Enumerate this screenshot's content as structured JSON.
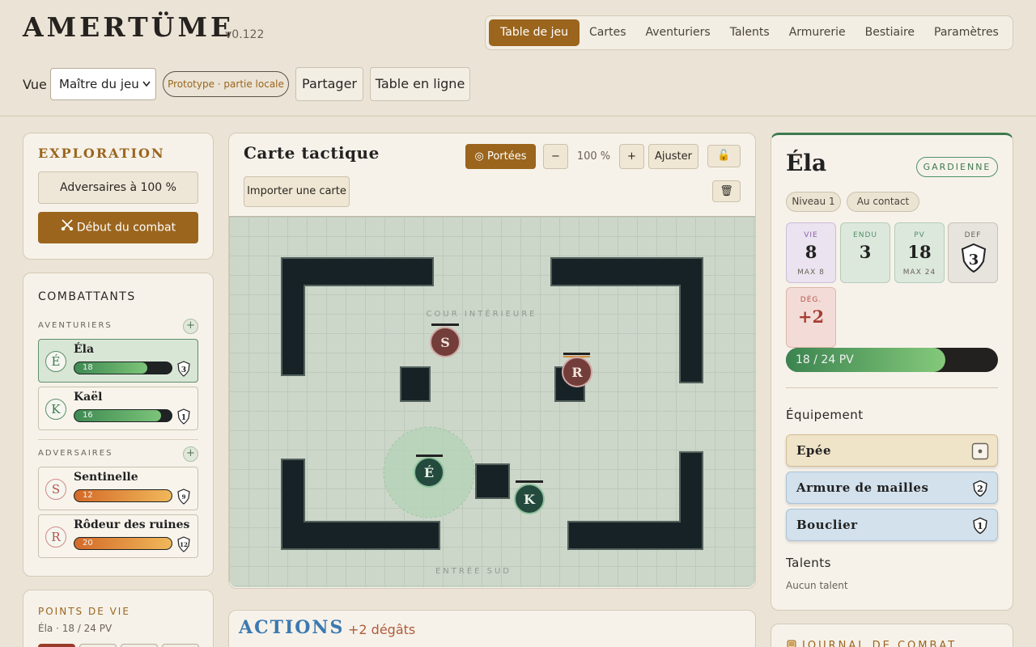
{
  "header": {
    "brand": "AMERTÜME",
    "version": "v0.122",
    "nav": [
      "Table de jeu",
      "Cartes",
      "Aventuriers",
      "Talents",
      "Armurerie",
      "Bestiaire",
      "Paramètres"
    ],
    "view_label": "Vue",
    "view_value": "Maître du jeu",
    "prototype_chip": "Prototype · partie locale",
    "share_button": "Partager",
    "online_button": "Table en ligne"
  },
  "exploration": {
    "title": "EXPLORATION",
    "adversaries_button": "Adversaires à 100 %",
    "start_combat_button": "Début du combat"
  },
  "combatants": {
    "title": "COMBATTANTS",
    "adventurers_label": "AVENTURIERS",
    "adversaries_label": "ADVERSAIRES",
    "adventurers": [
      {
        "initial": "É",
        "name": "Éla",
        "hp": "18",
        "hp_fraction": 0.75,
        "def": "3"
      },
      {
        "initial": "K",
        "name": "Kaël",
        "hp": "16",
        "hp_fraction": 0.89,
        "def": "1"
      }
    ],
    "adversaries": [
      {
        "initial": "S",
        "name": "Sentinelle",
        "hp": "12",
        "hp_fraction": 1.0,
        "def": "9"
      },
      {
        "initial": "R",
        "name": "Rôdeur des ruines",
        "hp": "20",
        "hp_fraction": 1.0,
        "def": "12"
      }
    ]
  },
  "hitpoints": {
    "title": "POINTS DE VIE",
    "subtitle": "Éla · 18 / 24 PV"
  },
  "map": {
    "title": "Carte tactique",
    "ranges_button": "◎ Portées",
    "zoom_out": "−",
    "zoom": "100 %",
    "zoom_in": "+",
    "fit_button": "Ajuster",
    "lock_icon": "🔓",
    "import_button": "Importer une carte",
    "trash_icon": "🗑",
    "label_courtyard": "COUR INTÉRIEURE",
    "label_entrance": "ENTRÉE SUD",
    "tokens": [
      {
        "initial": "S",
        "kind": "enemy"
      },
      {
        "initial": "R",
        "kind": "enemy"
      },
      {
        "initial": "É",
        "kind": "hero"
      },
      {
        "initial": "K",
        "kind": "hero"
      }
    ]
  },
  "actions": {
    "title": "ACTIONS",
    "damage": "+2 dégâts"
  },
  "character": {
    "name": "Éla",
    "class": "GARDIENNE",
    "tags": [
      "Niveau 1",
      "Au contact"
    ],
    "stats": {
      "vie": {
        "label": "VIE",
        "value": "8",
        "max": "MAX 8"
      },
      "endu": {
        "label": "ENDU",
        "value": "3"
      },
      "pv": {
        "label": "PV",
        "value": "18",
        "max": "MAX 24"
      },
      "def": {
        "label": "DEF",
        "value": "3"
      },
      "deg": {
        "label": "DÉG.",
        "value": "+2"
      }
    },
    "hp_bar": "18 / 24 PV",
    "hp_fraction": 0.75,
    "equipment_title": "Équipement",
    "equipment": [
      {
        "name": "Epée",
        "badge": ""
      },
      {
        "name": "Armure de mailles",
        "badge": "2"
      },
      {
        "name": "Bouclier",
        "badge": "1"
      }
    ],
    "talents_title": "Talents",
    "talents_empty": "Aucun talent"
  },
  "log": {
    "title": "JOURNAL DE COMBAT",
    "icon": "scroll-icon"
  },
  "colors": {
    "accent": "#9b651d",
    "hero": "#3d7a4f",
    "enemy": "#b5544c",
    "actions": "#3c79b0"
  }
}
